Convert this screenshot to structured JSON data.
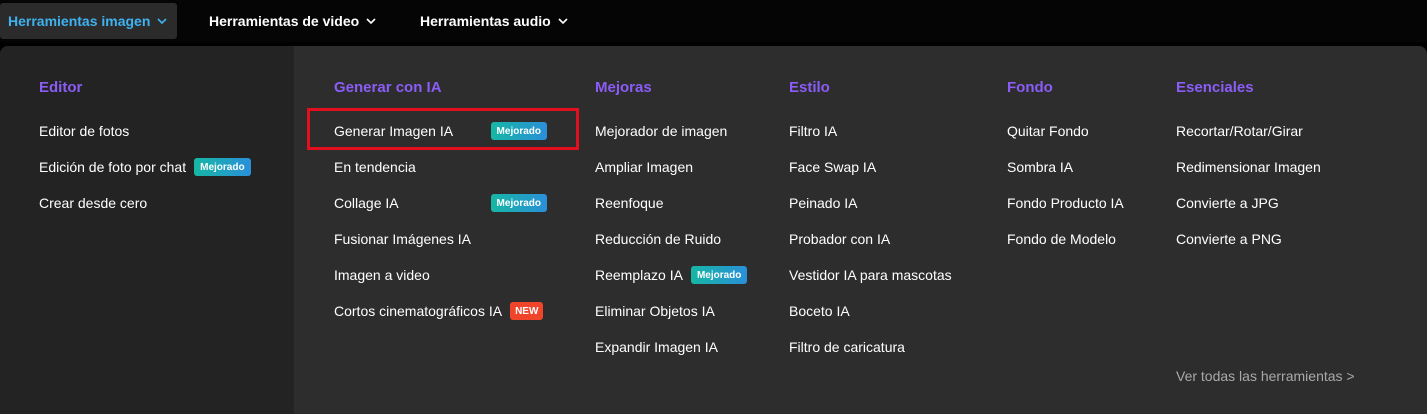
{
  "nav": {
    "tabs": [
      {
        "label": "Herramientas imagen",
        "active": true
      },
      {
        "label": "Herramientas de video",
        "active": false
      },
      {
        "label": "Herramientas audio",
        "active": false
      }
    ]
  },
  "colors": {
    "accent_title": "#8c5cf6",
    "active_tab_text": "#3fb2f0",
    "highlight_border": "#e2101f",
    "badge_new": "#f0452b"
  },
  "menu": {
    "editor": {
      "title": "Editor",
      "items": [
        {
          "label": "Editor de fotos"
        },
        {
          "label": "Edición de foto por chat",
          "badge": "Mejorado"
        },
        {
          "label": "Crear desde cero"
        }
      ]
    },
    "generar": {
      "title": "Generar con IA",
      "items": [
        {
          "label": "Generar Imagen IA",
          "badge": "Mejorado"
        },
        {
          "label": "En tendencia"
        },
        {
          "label": "Collage IA",
          "badge": "Mejorado"
        },
        {
          "label": "Fusionar Imágenes IA"
        },
        {
          "label": "Imagen a video"
        },
        {
          "label": "Cortos cinematográficos IA",
          "badge": "NEW"
        }
      ]
    },
    "mejoras": {
      "title": "Mejoras",
      "items": [
        {
          "label": "Mejorador de imagen"
        },
        {
          "label": "Ampliar Imagen"
        },
        {
          "label": "Reenfoque"
        },
        {
          "label": "Reducción de Ruido"
        },
        {
          "label": "Reemplazo IA",
          "badge": "Mejorado"
        },
        {
          "label": "Eliminar Objetos IA"
        },
        {
          "label": "Expandir Imagen IA"
        }
      ]
    },
    "estilo": {
      "title": "Estilo",
      "items": [
        {
          "label": "Filtro IA"
        },
        {
          "label": "Face Swap IA"
        },
        {
          "label": "Peinado IA"
        },
        {
          "label": "Probador con IA"
        },
        {
          "label": "Vestidor IA para mascotas"
        },
        {
          "label": "Boceto IA"
        },
        {
          "label": "Filtro de caricatura"
        }
      ]
    },
    "fondo": {
      "title": "Fondo",
      "items": [
        {
          "label": "Quitar Fondo"
        },
        {
          "label": "Sombra IA"
        },
        {
          "label": "Fondo Producto IA"
        },
        {
          "label": "Fondo de Modelo"
        }
      ]
    },
    "esenciales": {
      "title": "Esenciales",
      "items": [
        {
          "label": "Recortar/Rotar/Girar"
        },
        {
          "label": "Redimensionar Imagen"
        },
        {
          "label": "Convierte a JPG"
        },
        {
          "label": "Convierte a PNG"
        }
      ]
    }
  },
  "footer": {
    "view_all": "Ver todas las herramientas >"
  }
}
